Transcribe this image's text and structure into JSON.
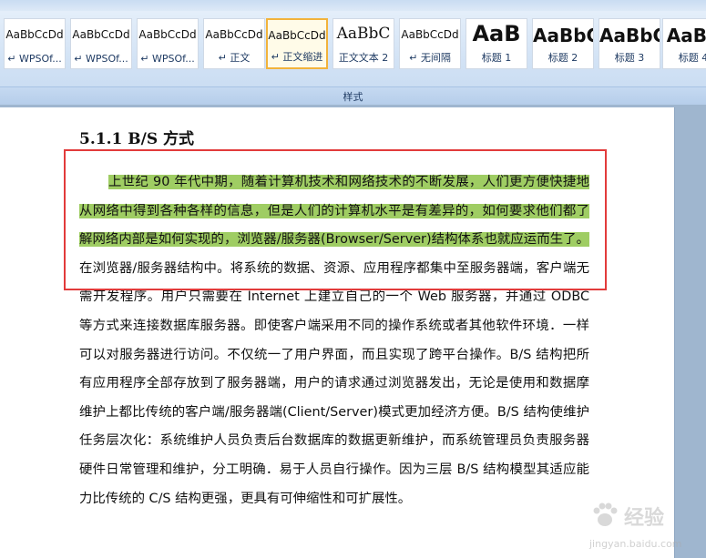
{
  "ribbon": {
    "group_label": "样式",
    "styles": [
      {
        "preview": "AaBbCcDd",
        "label": "↵ WPSOf...",
        "size": "small"
      },
      {
        "preview": "AaBbCcDd",
        "label": "↵ WPSOf...",
        "size": "small"
      },
      {
        "preview": "AaBbCcDd",
        "label": "↵ WPSOf...",
        "size": "small"
      },
      {
        "preview": "AaBbCcDd",
        "label": "↵ 正文",
        "size": "small"
      },
      {
        "preview": "AaBbCcDd",
        "label": "↵ 正文缩进",
        "size": "small"
      },
      {
        "preview": "AaBbC",
        "label": "正文文本 2",
        "size": "mid"
      },
      {
        "preview": "AaBbCcDd",
        "label": "↵ 无间隔",
        "size": "small"
      },
      {
        "preview": "AaB",
        "label": "标题 1",
        "size": "big"
      },
      {
        "preview": "AaBbC",
        "label": "标题 2",
        "size": "bold"
      },
      {
        "preview": "AaBbC",
        "label": "标题 3",
        "size": "bold"
      },
      {
        "preview": "AaBb",
        "label": "标题 4",
        "size": "bold"
      }
    ],
    "selected_index": 4
  },
  "document": {
    "heading": "5.1.1 B/S 方式",
    "highlighted_text": "上世纪 90 年代中期，随着计算机技术和网络技术的不断发展，人们更方便快捷地从网络中得到各种各样的信息，但是人们的计算机水平是有差异的，如何要求他们都了解网络内部是如何实现的，浏览器/服务器(Browser/Server)结构体系也就应运而生了。",
    "body_text": "在浏览器/服务器结构中。将系统的数据、资源、应用程序都集中至服务器端，客户端无需开发程序。用户只需要在 Internet 上建立自己的一个 Web 服务器，并通过 ODBC 等方式来连接数据库服务器。即使客户端采用不同的操作系统或者其他软件环境．一样可以对服务器进行访问。不仅统一了用户界面，而且实现了跨平台操作。B/S 结构把所有应用程序全部存放到了服务器端，用户的请求通过浏览器发出，无论是使用和数据摩维护上都比传统的客户端/服务器端(Client/Server)模式更加经济方便。B/S 结构使维护任务层次化：系统维护人员负责后台数据库的数据更新维护，而系统管理员负责服务器硬件日常管理和维护，分工明确．易于人员自行操作。因为三层 B/S 结构模型其适应能力比传统的 C/S 结构更强，更具有可伸缩性和可扩展性。"
  },
  "watermark": {
    "text": "经验",
    "url": "jingyan.baidu.com"
  },
  "colors": {
    "highlight": "#9fcd63",
    "annotation_box": "#e23b3b",
    "selected_tile": "#f2b33b"
  }
}
